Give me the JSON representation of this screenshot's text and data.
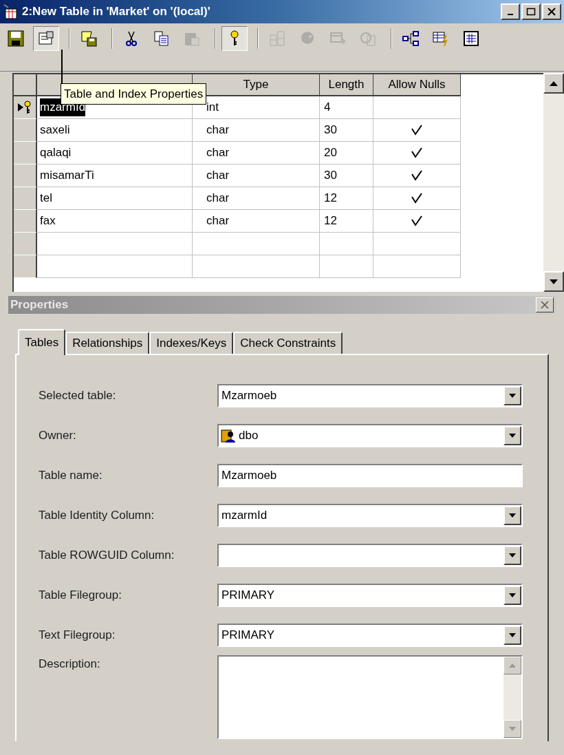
{
  "window": {
    "title": "2:New Table in 'Market' on '(local)'"
  },
  "toolbar": {
    "groups": [
      [
        {
          "disabled": false,
          "pressed": false
        },
        {
          "disabled": false,
          "pressed": true
        }
      ],
      [
        {
          "disabled": false,
          "pressed": false
        }
      ],
      [
        {
          "disabled": false,
          "pressed": false
        },
        {
          "disabled": false,
          "pressed": false
        },
        {
          "disabled": true,
          "pressed": false
        }
      ],
      [
        {
          "disabled": false,
          "pressed": true
        }
      ],
      [
        {
          "disabled": true,
          "pressed": false
        },
        {
          "disabled": true,
          "pressed": false
        },
        {
          "disabled": true,
          "pressed": false
        },
        {
          "disabled": true,
          "pressed": false
        }
      ],
      [
        {
          "disabled": false,
          "pressed": false
        },
        {
          "disabled": false,
          "pressed": false
        },
        {
          "disabled": false,
          "pressed": false
        }
      ]
    ]
  },
  "tooltip": "Table and Index Properties",
  "grid": {
    "columns": [
      "",
      "Type",
      "Length",
      "Allow Nulls"
    ],
    "rows": [
      {
        "name": "mzarmId",
        "type": "int",
        "length": "4",
        "allow_nulls": false,
        "current": true,
        "primary_key": true
      },
      {
        "name": "saxeli",
        "type": "char",
        "length": "30",
        "allow_nulls": true,
        "current": false,
        "primary_key": false
      },
      {
        "name": "qalaqi",
        "type": "char",
        "length": "20",
        "allow_nulls": true,
        "current": false,
        "primary_key": false
      },
      {
        "name": "misamarTi",
        "type": "char",
        "length": "30",
        "allow_nulls": true,
        "current": false,
        "primary_key": false
      },
      {
        "name": "tel",
        "type": "char",
        "length": "12",
        "allow_nulls": true,
        "current": false,
        "primary_key": false
      },
      {
        "name": "fax",
        "type": "char",
        "length": "12",
        "allow_nulls": true,
        "current": false,
        "primary_key": false
      }
    ]
  },
  "properties": {
    "title": "Properties",
    "tabs": [
      {
        "label": "Tables",
        "selected": true
      },
      {
        "label": "Relationships",
        "selected": false
      },
      {
        "label": "Indexes/Keys",
        "selected": false
      },
      {
        "label": "Check Constraints",
        "selected": false
      }
    ],
    "fields": [
      {
        "label": "Selected table:",
        "kind": "dropdown",
        "value": "Mzarmoeb"
      },
      {
        "label": "Owner:",
        "kind": "owner",
        "value": "dbo"
      },
      {
        "label": "Table name:",
        "kind": "text",
        "value": "Mzarmoeb"
      },
      {
        "label": "Table Identity Column:",
        "kind": "dropdown",
        "value": "mzarmId"
      },
      {
        "label": "Table ROWGUID Column:",
        "kind": "dropdown"
      },
      {
        "label": "Table Filegroup:",
        "kind": "dropdown",
        "value": "PRIMARY"
      },
      {
        "label": "Text Filegroup:",
        "kind": "dropdown",
        "value": "PRIMARY"
      },
      {
        "label": "Description:",
        "kind": "textarea"
      }
    ]
  }
}
